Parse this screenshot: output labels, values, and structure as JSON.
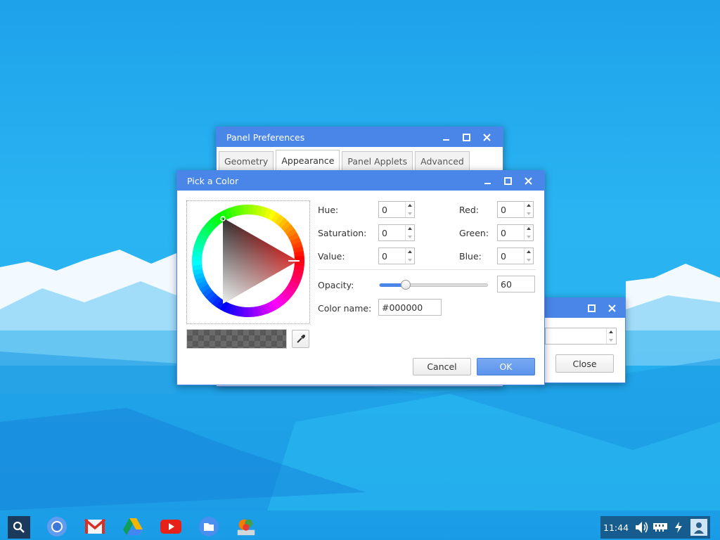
{
  "prefs_window": {
    "title": "Panel Preferences",
    "tabs": [
      {
        "label": "Geometry",
        "active": false
      },
      {
        "label": "Appearance",
        "active": true
      },
      {
        "label": "Panel Applets",
        "active": false
      },
      {
        "label": "Advanced",
        "active": false
      }
    ]
  },
  "back_window": {
    "close_label": "Close"
  },
  "color_window": {
    "title": "Pick a Color",
    "hue": {
      "label": "Hue:",
      "value": "0"
    },
    "saturation": {
      "label": "Saturation:",
      "value": "0"
    },
    "value": {
      "label": "Value:",
      "value": "0"
    },
    "red": {
      "label": "Red:",
      "value": "0"
    },
    "green": {
      "label": "Green:",
      "value": "0"
    },
    "blue": {
      "label": "Blue:",
      "value": "0"
    },
    "opacity": {
      "label": "Opacity:",
      "value": "60",
      "level": 0.24
    },
    "color_name": {
      "label": "Color name:",
      "value": "#000000"
    },
    "cancel_label": "Cancel",
    "ok_label": "OK"
  },
  "taskbar": {
    "items": [
      "search-icon",
      "chromium-icon",
      "gmail-icon",
      "drive-icon",
      "youtube-icon",
      "files-icon",
      "paint-icon"
    ],
    "clock": "11:44"
  },
  "colors": {
    "titlebar": "#4a86e8",
    "accent": "#4a86e8"
  }
}
